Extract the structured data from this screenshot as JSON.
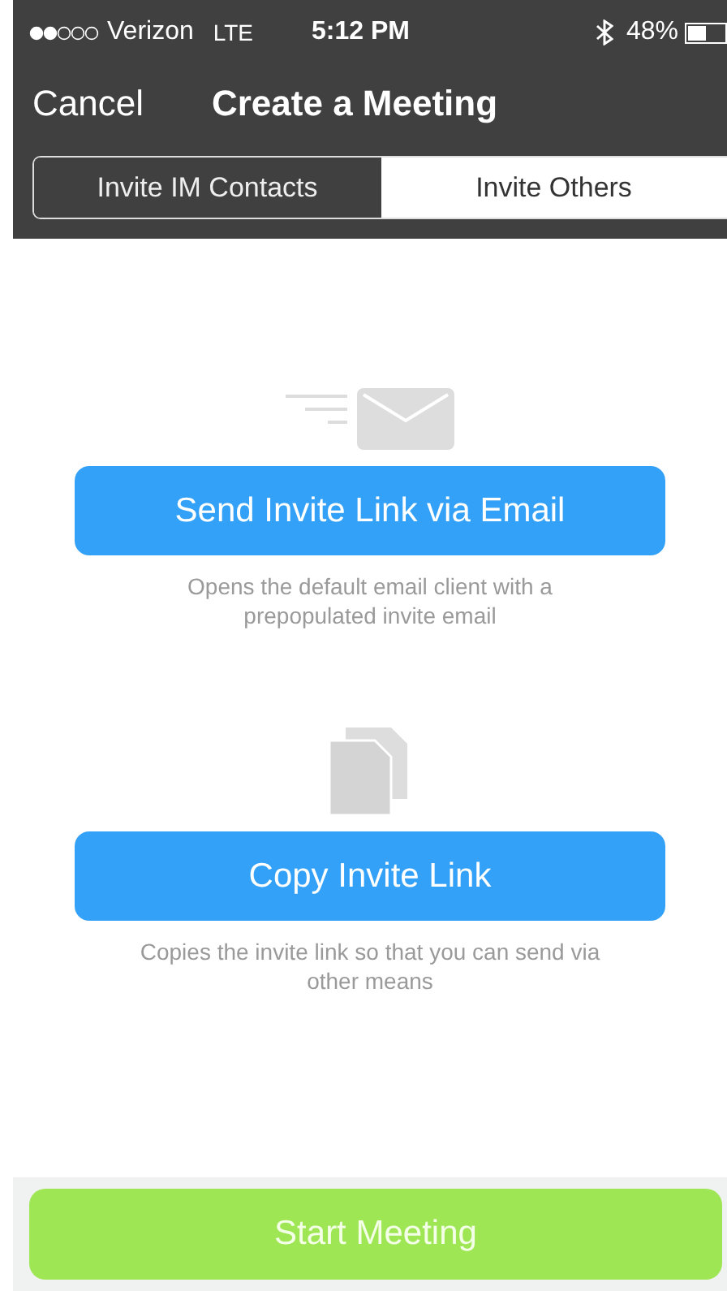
{
  "status_bar": {
    "carrier": "Verizon",
    "network": "LTE",
    "time": "5:12 PM",
    "battery": "48%"
  },
  "nav": {
    "cancel": "Cancel",
    "title": "Create a Meeting"
  },
  "tabs": [
    {
      "label": "Invite IM Contacts",
      "selected": false
    },
    {
      "label": "Invite Others",
      "selected": true
    }
  ],
  "actions": [
    {
      "kind": "email",
      "button": "Send Invite Link via Email",
      "caption": "Opens the default email client with a prepopulated invite email"
    },
    {
      "kind": "copy",
      "button": "Copy Invite Link",
      "caption": "Copies the invite link so that you can send via other means"
    }
  ],
  "footer": {
    "button": "Start Meeting"
  }
}
